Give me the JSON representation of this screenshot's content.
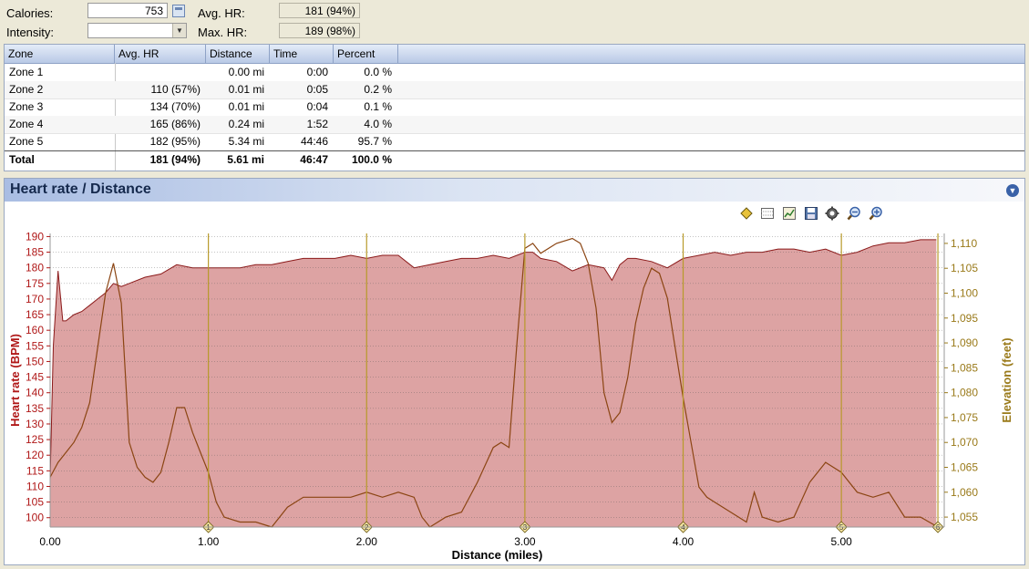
{
  "summary": {
    "calories_label": "Calories:",
    "calories_value": "753",
    "intensity_label": "Intensity:",
    "intensity_value": "",
    "avg_hr_label": "Avg. HR:",
    "avg_hr_value": "181 (94%)",
    "max_hr_label": "Max. HR:",
    "max_hr_value": "189 (98%)"
  },
  "zones": {
    "headers": [
      "Zone",
      "Avg. HR",
      "Distance",
      "Time",
      "Percent"
    ],
    "rows": [
      [
        "Zone 1",
        "",
        "0.00 mi",
        "0:00",
        "0.0 %"
      ],
      [
        "Zone 2",
        "110 (57%)",
        "0.01 mi",
        "0:05",
        "0.2 %"
      ],
      [
        "Zone 3",
        "134 (70%)",
        "0.01 mi",
        "0:04",
        "0.1 %"
      ],
      [
        "Zone 4",
        "165 (86%)",
        "0.24 mi",
        "1:52",
        "4.0 %"
      ],
      [
        "Zone 5",
        "182 (95%)",
        "5.34 mi",
        "44:46",
        "95.7 %"
      ]
    ],
    "total": [
      "Total",
      "181 (94%)",
      "5.61 mi",
      "46:47",
      "100.0 %"
    ]
  },
  "panel": {
    "title": "Heart rate / Distance",
    "toolbar_icons": [
      "diamond-marker-icon",
      "grid-icon",
      "chart-icon",
      "save-icon",
      "settings-icon",
      "zoom-out-icon",
      "zoom-in-icon"
    ]
  },
  "colors": {
    "hr_fill": "#dda3a3",
    "hr_line": "#8b1a1a",
    "elevation_line": "#8b4513",
    "elevation_axis": "#9a7a1a",
    "hr_axis": "#b01818",
    "marker": "#b89a2a"
  },
  "chart_data": {
    "type": "area",
    "xlabel": "Distance (miles)",
    "ylabel": "Heart rate (BPM)",
    "y2label": "Elevation (feet)",
    "xlim": [
      0,
      5.65
    ],
    "ylim": [
      97,
      191
    ],
    "y2lim": [
      1053,
      1112
    ],
    "x_ticks": [
      "0.00",
      "1.00",
      "2.00",
      "3.00",
      "4.00",
      "5.00"
    ],
    "y_ticks": [
      "100",
      "105",
      "110",
      "115",
      "120",
      "125",
      "130",
      "135",
      "140",
      "145",
      "150",
      "155",
      "160",
      "165",
      "170",
      "175",
      "180",
      "185",
      "190"
    ],
    "y2_ticks": [
      "1,055",
      "1,060",
      "1,065",
      "1,070",
      "1,075",
      "1,080",
      "1,085",
      "1,090",
      "1,095",
      "1,100",
      "1,105",
      "1,110"
    ],
    "mile_markers": [
      {
        "x": 1,
        "label": "1"
      },
      {
        "x": 2,
        "label": "2"
      },
      {
        "x": 3,
        "label": "3"
      },
      {
        "x": 4,
        "label": "4"
      },
      {
        "x": 5,
        "label": "5"
      },
      {
        "x": 5.61,
        "label": "6"
      }
    ],
    "series": [
      {
        "name": "Heart rate (BPM)",
        "x": [
          0,
          0.02,
          0.05,
          0.08,
          0.1,
          0.15,
          0.2,
          0.25,
          0.3,
          0.35,
          0.4,
          0.45,
          0.5,
          0.6,
          0.7,
          0.8,
          0.9,
          1.0,
          1.1,
          1.2,
          1.3,
          1.4,
          1.5,
          1.6,
          1.7,
          1.8,
          1.9,
          2.0,
          2.1,
          2.2,
          2.3,
          2.4,
          2.5,
          2.6,
          2.7,
          2.8,
          2.9,
          3.0,
          3.05,
          3.1,
          3.2,
          3.3,
          3.4,
          3.5,
          3.55,
          3.6,
          3.65,
          3.7,
          3.8,
          3.9,
          4.0,
          4.1,
          4.2,
          4.3,
          4.4,
          4.5,
          4.6,
          4.7,
          4.8,
          4.9,
          5.0,
          5.1,
          5.2,
          5.3,
          5.4,
          5.5,
          5.6
        ],
        "values": [
          112,
          155,
          179,
          163,
          163,
          165,
          166,
          168,
          170,
          172,
          175,
          174,
          175,
          177,
          178,
          181,
          180,
          180,
          180,
          180,
          181,
          181,
          182,
          183,
          183,
          183,
          184,
          183,
          184,
          184,
          180,
          181,
          182,
          183,
          183,
          184,
          183,
          185,
          185,
          183,
          182,
          179,
          181,
          180,
          176,
          181,
          183,
          183,
          182,
          180,
          183,
          184,
          185,
          184,
          185,
          185,
          186,
          186,
          185,
          186,
          184,
          185,
          187,
          188,
          188,
          189,
          189
        ]
      },
      {
        "name": "Elevation (feet)",
        "x": [
          0,
          0.05,
          0.1,
          0.15,
          0.2,
          0.25,
          0.3,
          0.35,
          0.4,
          0.45,
          0.5,
          0.55,
          0.6,
          0.65,
          0.7,
          0.75,
          0.8,
          0.85,
          0.9,
          0.95,
          1.0,
          1.05,
          1.1,
          1.2,
          1.3,
          1.4,
          1.5,
          1.6,
          1.7,
          1.8,
          1.9,
          2.0,
          2.1,
          2.2,
          2.3,
          2.35,
          2.4,
          2.5,
          2.6,
          2.7,
          2.8,
          2.85,
          2.9,
          2.95,
          3.0,
          3.05,
          3.1,
          3.2,
          3.3,
          3.35,
          3.4,
          3.45,
          3.5,
          3.55,
          3.6,
          3.65,
          3.7,
          3.75,
          3.8,
          3.85,
          3.9,
          3.95,
          4.0,
          4.05,
          4.1,
          4.15,
          4.2,
          4.3,
          4.4,
          4.45,
          4.5,
          4.6,
          4.7,
          4.8,
          4.9,
          5.0,
          5.1,
          5.2,
          5.3,
          5.4,
          5.5,
          5.61
        ],
        "values": [
          1063,
          1066,
          1068,
          1070,
          1073,
          1078,
          1089,
          1100,
          1106,
          1098,
          1070,
          1065,
          1063,
          1062,
          1064,
          1070,
          1077,
          1077,
          1072,
          1068,
          1064,
          1058,
          1055,
          1054,
          1054,
          1053,
          1057,
          1059,
          1059,
          1059,
          1059,
          1060,
          1059,
          1060,
          1059,
          1055,
          1053,
          1055,
          1056,
          1062,
          1069,
          1070,
          1069,
          1090,
          1109,
          1110,
          1108,
          1110,
          1111,
          1110,
          1106,
          1097,
          1080,
          1074,
          1076,
          1083,
          1094,
          1101,
          1105,
          1104,
          1099,
          1089,
          1079,
          1070,
          1061,
          1059,
          1058,
          1056,
          1054,
          1060,
          1055,
          1054,
          1055,
          1062,
          1066,
          1064,
          1060,
          1059,
          1060,
          1055,
          1055,
          1053
        ]
      }
    ]
  }
}
